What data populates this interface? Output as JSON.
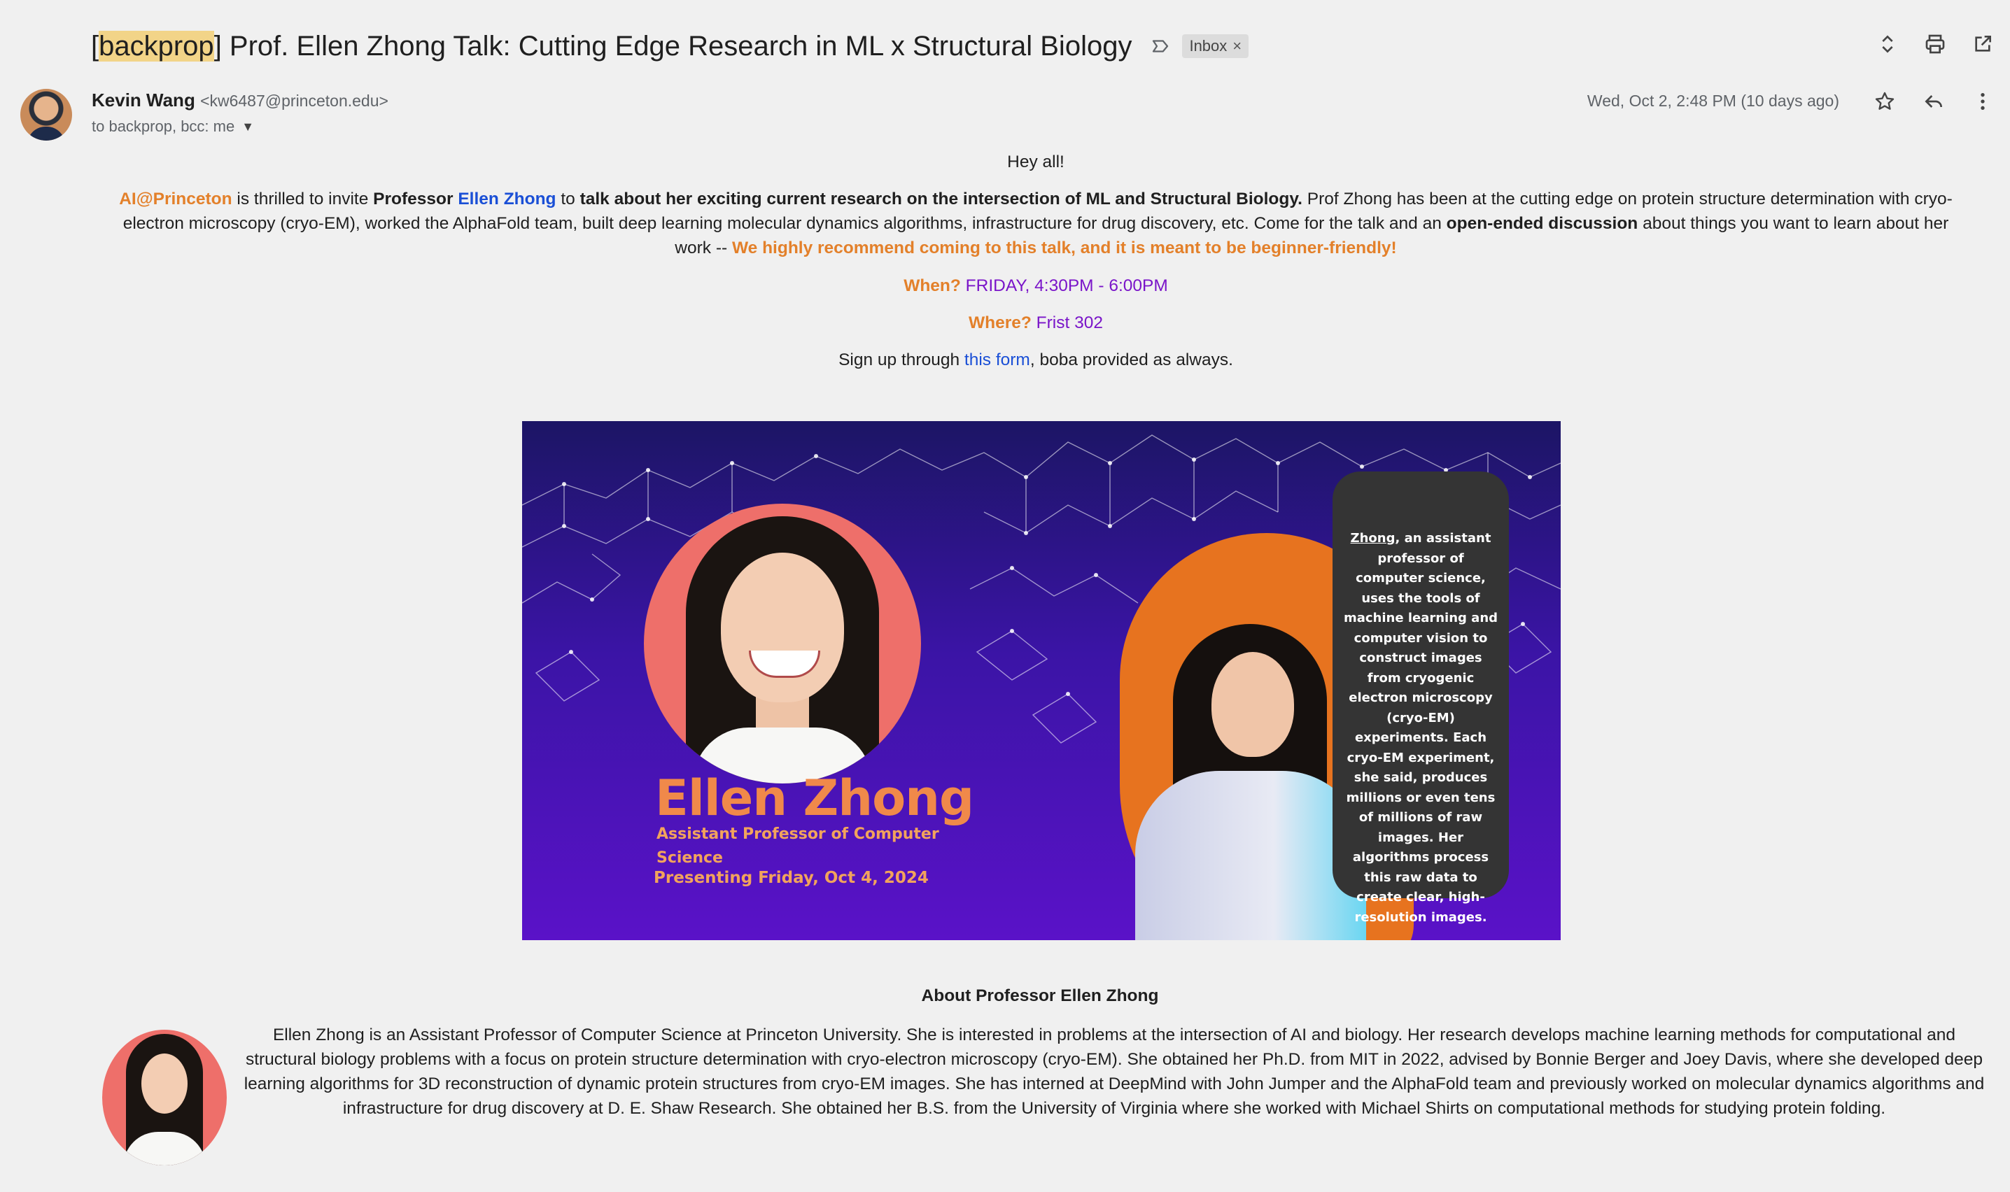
{
  "header": {
    "subject_prefix": "[",
    "subject_tag": "backprop",
    "subject_rest": "] Prof. Ellen Zhong Talk: Cutting Edge Research in ML x Structural Biology",
    "label_chip": "Inbox",
    "label_chip_close": "×"
  },
  "message": {
    "sender_name": "Kevin Wang",
    "sender_email": "<kw6487@princeton.edu>",
    "recipients": "to backprop, bcc: me",
    "date": "Wed, Oct 2, 2:48 PM (10 days ago)"
  },
  "body": {
    "greeting": "Hey all!",
    "p1": {
      "org": "AI@Princeton",
      "t1": " is thrilled to invite ",
      "prof": "Professor ",
      "name_link": "Ellen Zhong",
      "t2": " to ",
      "topic": "talk about her exciting current research on the intersection of ML and Structural Biology.",
      "t3": " Prof Zhong has been at the cutting edge on protein structure determination with cryo-electron microscopy (cryo-EM), worked the AlphaFold team, built deep learning molecular dynamics algorithms, infrastructure for drug discovery, etc. Come for the talk and an ",
      "discussion": "open-ended discussion",
      "t4": " about things you want to learn about her work -- ",
      "recommend": "We highly recommend coming to this talk, and it is meant to be beginner-friendly!"
    },
    "when_label": "When?",
    "when_value": " FRIDAY, 4:30PM - 6:00PM",
    "where_label": "Where?",
    "where_value": " Frist 302",
    "signup_pre": "Sign up through ",
    "signup_link": "this form",
    "signup_post": ", boba provided as always."
  },
  "banner": {
    "name": "Ellen Zhong",
    "title": "Assistant Professor of Computer Science",
    "date": "Presenting Friday, Oct 4, 2024",
    "quote_lead": "Zhong",
    "quote_rest": ", an assistant professor of computer science, uses the tools of machine learning and computer vision to construct images from cryogenic electron microscopy (cryo-EM) experiments. Each cryo-EM experiment, she said, produces millions or even tens of millions of raw images. Her algorithms process this raw data to create clear, high-resolution images."
  },
  "about": {
    "title": "About Professor Ellen Zhong",
    "text": "Ellen Zhong is an Assistant Professor of Computer Science at Princeton University. She is interested in problems at the intersection of AI and biology. Her research develops machine learning methods for computational and structural biology problems with a focus on protein structure determination with cryo-electron microscopy (cryo-EM). She obtained her Ph.D. from MIT in 2022, advised by Bonnie Berger and Joey Davis, where she developed deep learning algorithms for 3D reconstruction of dynamic protein structures from cryo-EM images. She has interned at DeepMind with John Jumper and the AlphaFold team and previously worked on molecular dynamics algorithms and infrastructure for drug discovery at D. E. Shaw Research. She obtained her B.S. from the University of Virginia where she worked with Michael Shirts on computational methods for studying protein folding."
  },
  "icons": {
    "important_marker": "label-important-icon",
    "expand": "unfold-icon",
    "print": "print-icon",
    "open_new_window": "open-in-new-icon",
    "star": "star-icon",
    "reply": "reply-icon",
    "more": "more-vert-icon"
  },
  "colors": {
    "accent_orange": "#e3802a",
    "accent_purple": "#7a15c9",
    "link_blue": "#1a4fd6",
    "highlight": "#f2d488"
  }
}
